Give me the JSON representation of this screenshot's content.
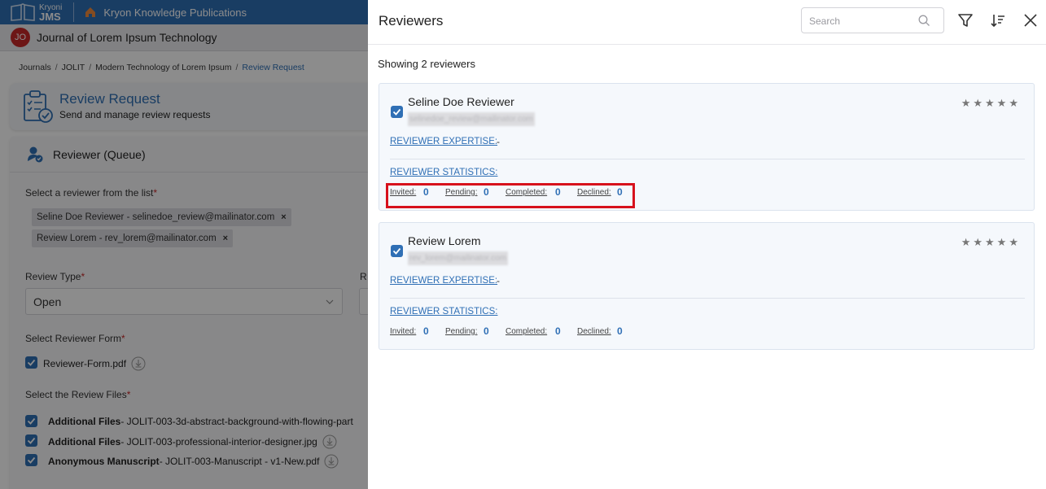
{
  "app": {
    "logo_top": "Kryoni",
    "logo_bottom": "JMS",
    "publisher": "Kryon Knowledge Publications",
    "journal_badge": "JO",
    "journal_title": "Journal of Lorem Ipsum Technology"
  },
  "breadcrumb": [
    "Journals",
    "JOLIT",
    "Modern Technology of Lorem Ipsum",
    "Review Request"
  ],
  "header": {
    "title": "Review Request",
    "subtitle": "Send and manage review requests"
  },
  "queue": {
    "title": "Reviewer (Queue)",
    "select_label": "Select a reviewer from the list",
    "chips": [
      "Seline Doe Reviewer - selinedoe_review@mailinator.com",
      "Review Lorem - rev_lorem@mailinator.com"
    ],
    "review_type_label": "Review Type",
    "review_type_value": "Open",
    "second_field_initial": "R",
    "reviewer_form_label": "Select Reviewer Form",
    "reviewer_form_file": "Reviewer-Form.pdf",
    "review_files_label": "Select the Review Files",
    "files": [
      {
        "type": "Additional Files",
        "name": " - JOLIT-003-3d-abstract-background-with-flowing-part"
      },
      {
        "type": "Additional Files",
        "name": " - JOLIT-003-professional-interior-designer.jpg"
      },
      {
        "type": "Anonymous Manuscript",
        "name": " - JOLIT-003-Manuscript - v1-New.pdf"
      }
    ]
  },
  "panel": {
    "title": "Reviewers",
    "search_placeholder": "Search",
    "count_text": "Showing 2 reviewers",
    "expertise_label": "REVIEWER EXPERTISE:",
    "statistics_label": "REVIEWER STATISTICS:",
    "stat_labels": [
      "Invited:",
      "Pending:",
      "Completed:",
      "Declined:"
    ],
    "stars": "★★★★★",
    "reviewers": [
      {
        "name": "Seline Doe Reviewer",
        "email": "selinedoe_review@mailinator.com",
        "expertise": "-",
        "stats": [
          "0",
          "0",
          "0",
          "0"
        ],
        "checked": true
      },
      {
        "name": "Review Lorem",
        "email": "rev_lorem@mailinator.com",
        "expertise": "-",
        "stats": [
          "0",
          "0",
          "0",
          "0"
        ],
        "checked": true
      }
    ]
  },
  "colors": {
    "brand": "#2f6fb5",
    "highlight": "#d7111c",
    "required": "#c62828"
  }
}
